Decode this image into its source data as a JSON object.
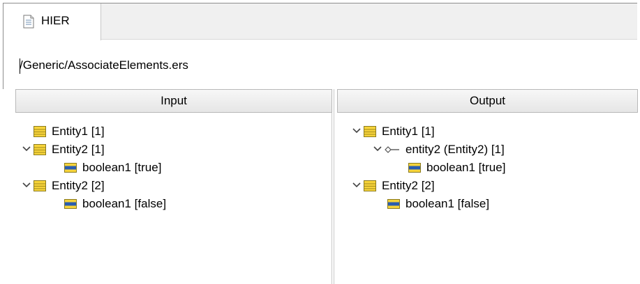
{
  "tab": {
    "label": "HIER",
    "icon": "document-icon"
  },
  "path": "/Generic/AssociateElements.ers",
  "input_pane": {
    "header": "Input",
    "rows": [
      {
        "label": "Entity1 [1]",
        "icon": "entity-icon",
        "expanded": false
      },
      {
        "label": "Entity2 [1]",
        "icon": "entity-icon",
        "expanded": true
      },
      {
        "label": "boolean1 [true]",
        "icon": "attribute-icon"
      },
      {
        "label": "Entity2 [2]",
        "icon": "entity-icon",
        "expanded": true
      },
      {
        "label": "boolean1 [false]",
        "icon": "attribute-icon"
      }
    ]
  },
  "output_pane": {
    "header": "Output",
    "rows": [
      {
        "label": "Entity1 [1]",
        "icon": "entity-icon",
        "expanded": true
      },
      {
        "label": "entity2 (Entity2) [1]",
        "icon": "association-icon",
        "expanded": true
      },
      {
        "label": "boolean1 [true]",
        "icon": "attribute-icon"
      },
      {
        "label": "Entity2 [2]",
        "icon": "entity-icon",
        "expanded": true
      },
      {
        "label": "boolean1 [false]",
        "icon": "attribute-icon"
      }
    ]
  }
}
